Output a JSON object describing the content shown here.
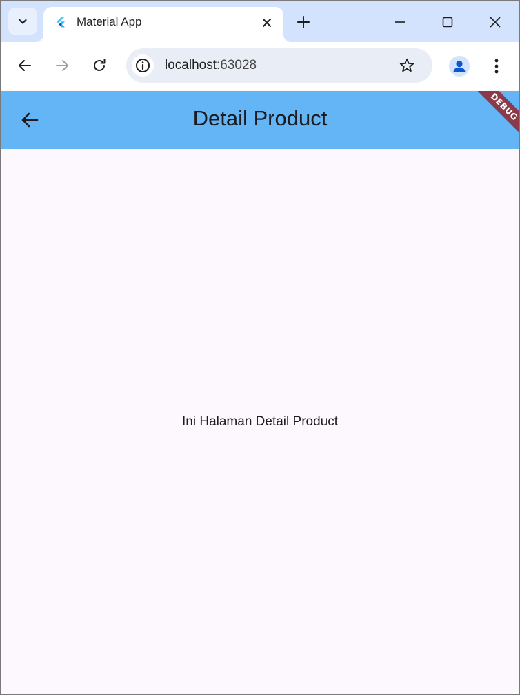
{
  "browser": {
    "tab": {
      "title": "Material App",
      "favicon": "flutter-logo-icon"
    },
    "icons": {
      "tab_search": "chevron-down-icon",
      "tab_close": "close-icon",
      "new_tab": "plus-icon",
      "minimize": "minimize-icon",
      "maximize": "maximize-icon",
      "close_window": "close-icon",
      "back": "arrow-left-icon",
      "forward": "arrow-right-icon",
      "reload": "reload-icon",
      "site_info": "info-icon",
      "bookmark": "star-icon",
      "profile": "person-icon",
      "menu": "kebab-icon"
    },
    "address": {
      "host": "localhost",
      "port": ":63028"
    }
  },
  "app": {
    "appbar": {
      "title": "Detail Product",
      "back_icon": "arrow-left-icon",
      "color": "#64b5f6"
    },
    "debug_banner": "DEBUG",
    "body_text": "Ini Halaman Detail Product",
    "background": "#fdf7fe"
  }
}
